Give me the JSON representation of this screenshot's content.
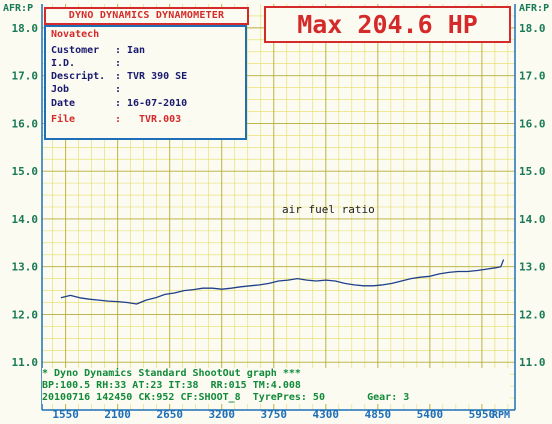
{
  "header": {
    "title": "DYNO DYNAMICS DYNAMOMETER"
  },
  "max_label": "Max 204.6 HP",
  "info": {
    "company": "Novatech",
    "rows": [
      {
        "label": "Customer",
        "sep": ":",
        "value": "Ian"
      },
      {
        "label": "I.D.",
        "sep": ":",
        "value": ""
      },
      {
        "label": "Descript.",
        "sep": ":",
        "value": "TVR 390 SE"
      },
      {
        "label": "Job",
        "sep": ":",
        "value": ""
      },
      {
        "label": "Date",
        "sep": ":",
        "value": "16-07-2010"
      }
    ],
    "file_label": "File",
    "file_sep": ":",
    "file_value": "TVR.003"
  },
  "footer": {
    "line1": "* Dyno Dynamics Standard ShootOut graph ***",
    "line2": "BP:100.5 RH:33 AT:23 IT:38  RR:015 TM:4.008",
    "line3": "20100716 142450 CK:952 CF:SHOOT_8  TyrePres: 50       Gear: 3"
  },
  "colors": {
    "grid_yellow": "#e6dc60",
    "axis_blue": "#1e6fb8",
    "line_blue": "#1f3f8a",
    "red": "#d42a2a",
    "green_text": "#128a3a",
    "label_green": "#1a7a55"
  },
  "chart_data": {
    "type": "line",
    "title": "",
    "xlabel": "RPM",
    "ylabel": "AFR:P",
    "xlim": [
      1300,
      6300
    ],
    "ylim": [
      10.0,
      18.5
    ],
    "x_ticks": [
      "1550",
      "2100",
      "2650",
      "3200",
      "3750",
      "4300",
      "4850",
      "5400",
      "5950"
    ],
    "y_ticks": [
      "11.0",
      "12.0",
      "13.0",
      "14.0",
      "15.0",
      "16.0",
      "17.0",
      "18.0"
    ],
    "grid": true,
    "annotations": [
      "air fuel ratio"
    ],
    "series": [
      {
        "name": "air fuel ratio",
        "x": [
          1500,
          1600,
          1700,
          1800,
          1900,
          2000,
          2100,
          2200,
          2300,
          2400,
          2500,
          2600,
          2700,
          2800,
          2900,
          3000,
          3100,
          3200,
          3300,
          3400,
          3500,
          3600,
          3700,
          3800,
          3900,
          4000,
          4100,
          4200,
          4300,
          4400,
          4500,
          4600,
          4700,
          4800,
          4900,
          5000,
          5100,
          5200,
          5300,
          5400,
          5500,
          5600,
          5700,
          5800,
          5900,
          6000,
          6100,
          6150,
          6180
        ],
        "y": [
          12.35,
          12.4,
          12.35,
          12.32,
          12.3,
          12.28,
          12.27,
          12.25,
          12.22,
          12.3,
          12.35,
          12.42,
          12.45,
          12.5,
          12.52,
          12.55,
          12.55,
          12.53,
          12.55,
          12.58,
          12.6,
          12.62,
          12.65,
          12.7,
          12.72,
          12.75,
          12.72,
          12.7,
          12.72,
          12.7,
          12.65,
          12.62,
          12.6,
          12.6,
          12.62,
          12.65,
          12.7,
          12.75,
          12.78,
          12.8,
          12.85,
          12.88,
          12.9,
          12.9,
          12.92,
          12.95,
          12.98,
          13.0,
          13.15
        ]
      }
    ]
  }
}
